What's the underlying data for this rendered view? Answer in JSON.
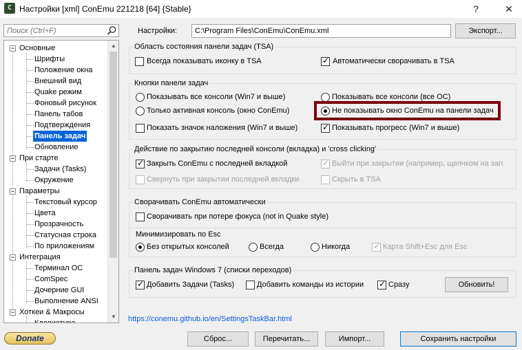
{
  "window": {
    "title": "Настройки [xml] ConEmu 221218 [64] {Stable}",
    "help_label": "?",
    "close_label": "✕"
  },
  "search": {
    "placeholder": "Поиск (Ctrl+F)"
  },
  "tree": {
    "osnovnye": "Основные",
    "shrifty": "Шрифты",
    "polozhenie": "Положение окна",
    "vneshniy": "Внешний вид",
    "quake": "Quake режим",
    "fon": "Фоновый рисунок",
    "tabs": "Панель табов",
    "confirm": "Подтверждения",
    "taskbar": "Панель задач",
    "update": "Обновление",
    "startup": "При старте",
    "tasks": "Задачи (Tasks)",
    "env": "Окружение",
    "params": "Параметры",
    "cursor": "Текстовый курсор",
    "colors": "Цвета",
    "transparency": "Прозрачность",
    "statusbar": "Статусная строка",
    "apps": "По приложениям",
    "integration": "Интеграция",
    "terminal": "Терминал ОС",
    "comspec": "ComSpec",
    "childgui": "Дочерние GUI",
    "ansi": "Выполнение ANSI",
    "hotkeys": "Хоткеи & Макросы",
    "keyboard": "Клавиатура"
  },
  "header": {
    "settings_label": "Настройки:",
    "path": "C:\\Program Files\\ConEmu\\ConEmu.xml",
    "export_label": "Экспорт..."
  },
  "tsa": {
    "title": "Область состояния панели задач (TSA)",
    "always_icon": "Всегда показывать иконку в TSA",
    "auto_minimize": "Автоматически сворачивать в TSA"
  },
  "taskbar_buttons": {
    "title": "Кнопки панели задач",
    "show_all_win7": "Показывать все консоли (Win7 и выше)",
    "show_all_os": "Показывать все консоли (все ОС)",
    "active_only": "Только активная консоль (окно ConEmu)",
    "dont_show": "Не показывать окно ConEmu на панели задач",
    "overlay_icon": "Показать значок наложения (Win7 и выше)",
    "progress": "Показывать прогресс (Win7 и выше)"
  },
  "close_action": {
    "title": "Действие по закрытию последней консоли (вкладка) и 'cross clicking'",
    "close_with_last": "Закрыть ConEmu с последней вкладкой",
    "exit_on_close": "Выйти при закрытии (например, щелчком на заго",
    "minimize_on_close": "Свернуть при закрытии последней вкладки",
    "hide_tsa": "Скрыть в TSA"
  },
  "auto_minimize": {
    "title": "Сворачивать ConEmu автоматически",
    "on_focus_loss": "Сворачивать при потере фокуса (not in Quake style)"
  },
  "esc": {
    "title": "Минимизировать по Esc",
    "no_consoles": "Без открытых консолей",
    "always": "Всегда",
    "never": "Никогда",
    "map_shift_esc": "Карта Shift+Esc для Esc"
  },
  "jumplist": {
    "title": "Панель задач Windows 7 (списки переходов)",
    "add_tasks": "Добавить Задачи (Tasks)",
    "add_history": "Добавить команды из истории",
    "immediately": "Сразу",
    "update_label": "Обновить!"
  },
  "footer": {
    "link": "https://conemu.github.io/en/SettingsTaskBar.html",
    "donate": "Donate",
    "reset": "Сброс...",
    "reload": "Перечитать...",
    "import": "Импорт...",
    "save": "Сохранить настройки"
  }
}
